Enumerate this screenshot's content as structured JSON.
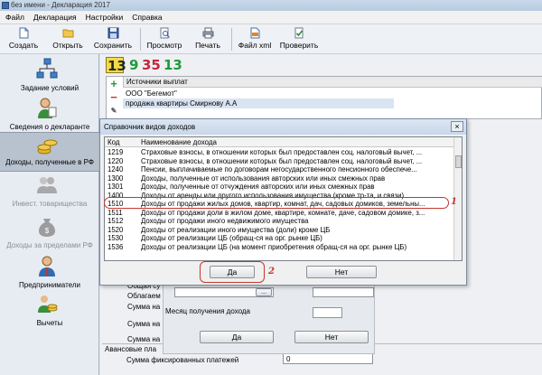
{
  "window": {
    "title": "без имени - Декларация 2017"
  },
  "menu": [
    "Файл",
    "Декларация",
    "Настройки",
    "Справка"
  ],
  "toolbar": {
    "create": "Создать",
    "open": "Открыть",
    "save": "Сохранить",
    "preview": "Просмотр",
    "print": "Печать",
    "xml": "Файл xml",
    "check": "Проверить"
  },
  "sidebar": [
    {
      "label": "Задание условий",
      "icon": "network-icon"
    },
    {
      "label": "Сведения о декларанте",
      "icon": "person-icon"
    },
    {
      "label": "Доходы, полученные в РФ",
      "icon": "coins-icon"
    },
    {
      "label": "Инвест. товарищества",
      "icon": "people-icon"
    },
    {
      "label": "Доходы за пределами РФ",
      "icon": "moneybag-icon"
    },
    {
      "label": "Предприниматели",
      "icon": "businessman-icon"
    },
    {
      "label": "Вычеты",
      "icon": "deductions-icon"
    }
  ],
  "rate_tabs": [
    "13",
    "9",
    "35",
    "13"
  ],
  "sources": {
    "header": "Источники выплат",
    "rows": [
      "ООО \"Бегемот\"",
      "продажа квартиры Смирнову А.А"
    ]
  },
  "bg_form": {
    "labels": [
      "Общая су",
      "Облагаем",
      "Сумма на",
      "Месяц получения дохода",
      "Сумма на",
      "Сумма на"
    ],
    "ellipsis": "...",
    "ok": "Да",
    "no": "Нет",
    "deductions_group": "Авансовые пла",
    "fixed_payments": "Сумма фиксированных платежей",
    "fixed_value": "0"
  },
  "dialog": {
    "title": "Справочник видов доходов",
    "close": "×",
    "col_code": "Код",
    "col_name": "Наименование дохода",
    "rows": [
      {
        "code": "1219",
        "name": "Страховые взносы, в отношении которых был предоставлен соц. налоговый вычет, ..."
      },
      {
        "code": "1220",
        "name": "Страховые взносы, в отношении которых был предоставлен соц. налоговый вычет, ..."
      },
      {
        "code": "1240",
        "name": "Пенсии, выплачиваемые по договорам негосударственного пенсионного обеспече..."
      },
      {
        "code": "1300",
        "name": "Доходы, полученные от использования авторских или иных смежных прав"
      },
      {
        "code": "1301",
        "name": "Доходы, полученные от отчуждения авторских или иных смежных прав"
      },
      {
        "code": "1400",
        "name": "Доходы от аренды или другого использования имущества (кроме тр-та, и связи)"
      },
      {
        "code": "1510",
        "name": "Доходы от продажи жилых домов, квартир, комнат, дач, садовых домиков, земельны..."
      },
      {
        "code": "1511",
        "name": "Доходы от продажи доли в жилом доме, квартире, комнате, даче, садовом домике, з..."
      },
      {
        "code": "1512",
        "name": "Доходы от продажи иного недвижимого имущества"
      },
      {
        "code": "1520",
        "name": "Доходы от реализации иного имущества (доли) кроме ЦБ"
      },
      {
        "code": "1530",
        "name": "Доходы от реализации ЦБ (обращ-ся на орг. рынке ЦБ)"
      },
      {
        "code": "1536",
        "name": "Доходы от реализации ЦБ (на момент приобретения обращ-ся на орг. рынке ЦБ)"
      }
    ],
    "ok": "Да",
    "no": "Нет",
    "annotation_1": "1",
    "annotation_2": "2"
  },
  "colors": {
    "accent": "#c0392b",
    "tab13": "#1c2a1c",
    "tab9": "#1e9a3c",
    "tab35": "#c3283a",
    "tab13b": "#1e9a3c",
    "highlight_bg": "#fff"
  }
}
